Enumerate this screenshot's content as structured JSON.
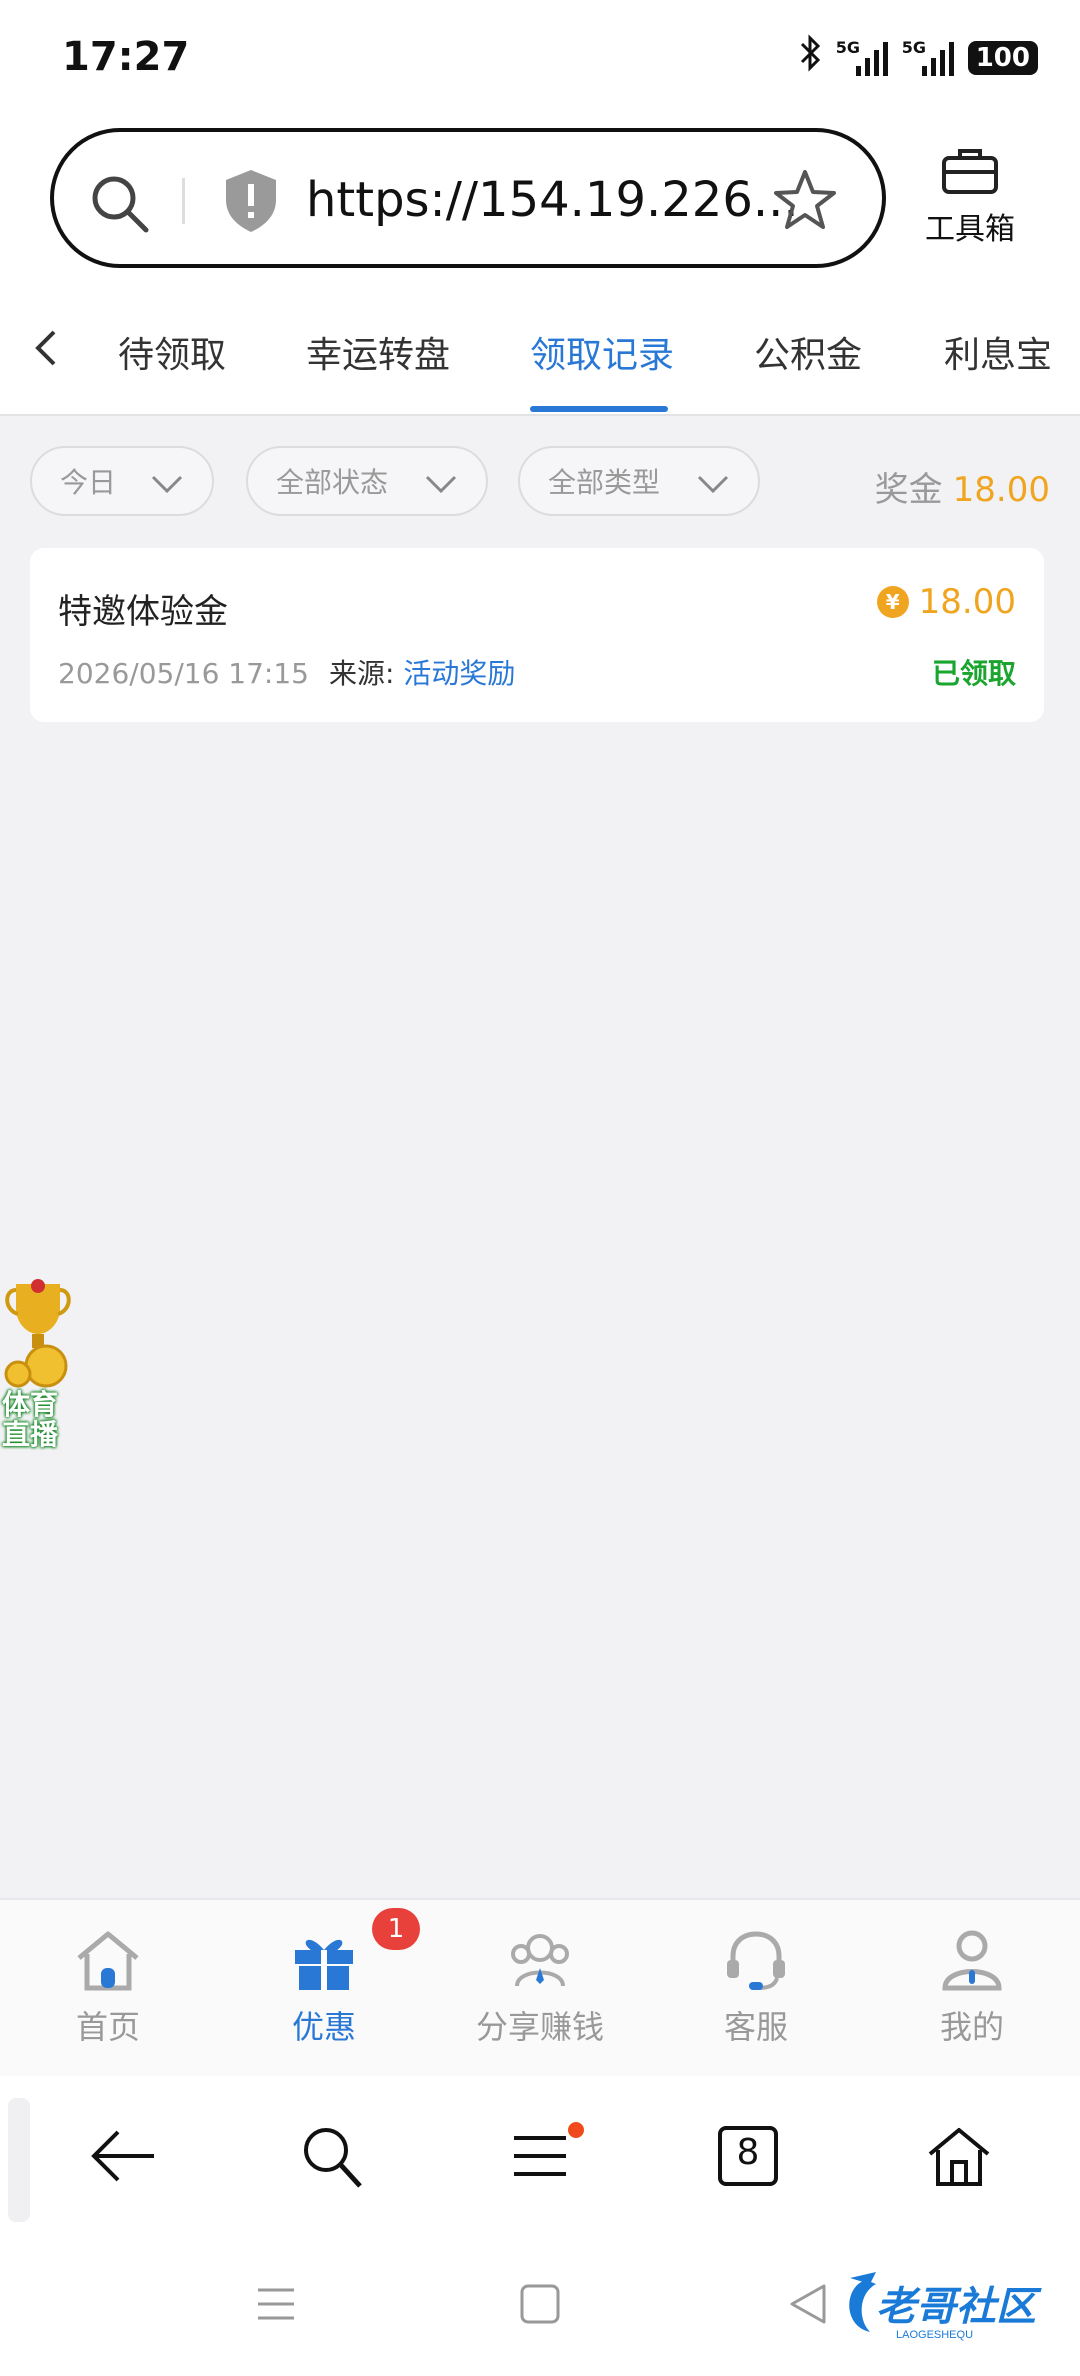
{
  "status_bar": {
    "time": "17:27",
    "network1": "5G",
    "network2": "5G",
    "battery": "100"
  },
  "address_bar": {
    "url": "https://154.19.226...",
    "toolbox_label": "工具箱"
  },
  "tabs": [
    {
      "label": "待领取",
      "active": false
    },
    {
      "label": "幸运转盘",
      "active": false
    },
    {
      "label": "领取记录",
      "active": true
    },
    {
      "label": "公积金",
      "active": false
    },
    {
      "label": "利息宝",
      "active": false
    }
  ],
  "filters": {
    "date": "今日",
    "status": "全部状态",
    "type": "全部类型",
    "bonus_label": "奖金",
    "bonus_amount": "18.00"
  },
  "records": [
    {
      "title": "特邀体验金",
      "amount": "18.00",
      "coin_symbol": "¥",
      "datetime": "2026/05/16 17:15",
      "source_label": "来源:",
      "source_value": "活动奖励",
      "status": "已领取"
    }
  ],
  "floating_widget": {
    "line1": "体育",
    "line2": "直播"
  },
  "bottom_nav": {
    "items": [
      {
        "label": "首页",
        "icon": "home-icon",
        "active": false
      },
      {
        "label": "优惠",
        "icon": "gift-icon",
        "active": true,
        "badge": "1"
      },
      {
        "label": "分享赚钱",
        "icon": "share-people-icon",
        "active": false
      },
      {
        "label": "客服",
        "icon": "headset-icon",
        "active": false
      },
      {
        "label": "我的",
        "icon": "user-icon",
        "active": false
      }
    ]
  },
  "browser_bar": {
    "tab_count": "8"
  },
  "colors": {
    "accent": "#2a78d6",
    "gold": "#f0a520",
    "success": "#1aa52e",
    "badge": "#e8413c"
  }
}
